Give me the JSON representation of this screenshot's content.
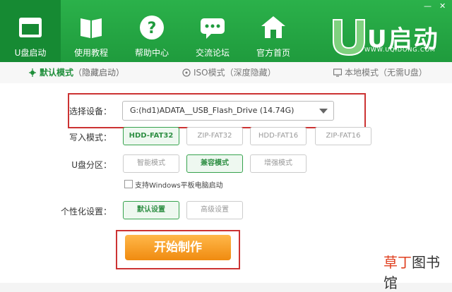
{
  "nav": [
    {
      "label": "U盘启动",
      "icon": "window-icon"
    },
    {
      "label": "使用教程",
      "icon": "book-icon"
    },
    {
      "label": "帮助中心",
      "icon": "help-icon"
    },
    {
      "label": "交流论坛",
      "icon": "chat-icon"
    },
    {
      "label": "官方首页",
      "icon": "home-icon"
    }
  ],
  "window": {
    "minimize": "—",
    "close": "✕"
  },
  "brand": {
    "name": "U启动",
    "url": "WWW.UQIDONG.COM"
  },
  "tabs": [
    {
      "label": "默认模式",
      "sub": "（隐藏启动）"
    },
    {
      "label": "ISO模式",
      "sub": "（深度隐藏）"
    },
    {
      "label": "本地模式",
      "sub": "（无需U盘）"
    }
  ],
  "device": {
    "label": "选择设备：",
    "value": "G:(hd1)ADATA__USB_Flash_Drive (14.74G)"
  },
  "write_mode": {
    "label": "写入模式：",
    "options": [
      "HDD-FAT32",
      "ZIP-FAT32",
      "HDD-FAT16",
      "ZIP-FAT16"
    ],
    "selected": 0
  },
  "partition": {
    "label": "U盘分区：",
    "options": [
      "智能模式",
      "兼容模式",
      "增强模式"
    ],
    "selected": 1
  },
  "windows_tablet": {
    "label": "支持Windows平板电脑启动",
    "checked": false
  },
  "personal": {
    "label": "个性化设置：",
    "options": [
      "默认设置",
      "高级设置"
    ],
    "selected": 0
  },
  "start_button": "开始制作",
  "watermark": {
    "part1": "草丁",
    "part2": "图书馆"
  },
  "colors": {
    "accent": "#1f9b3d",
    "highlight": "#cc3333",
    "button": "#f08b10"
  }
}
